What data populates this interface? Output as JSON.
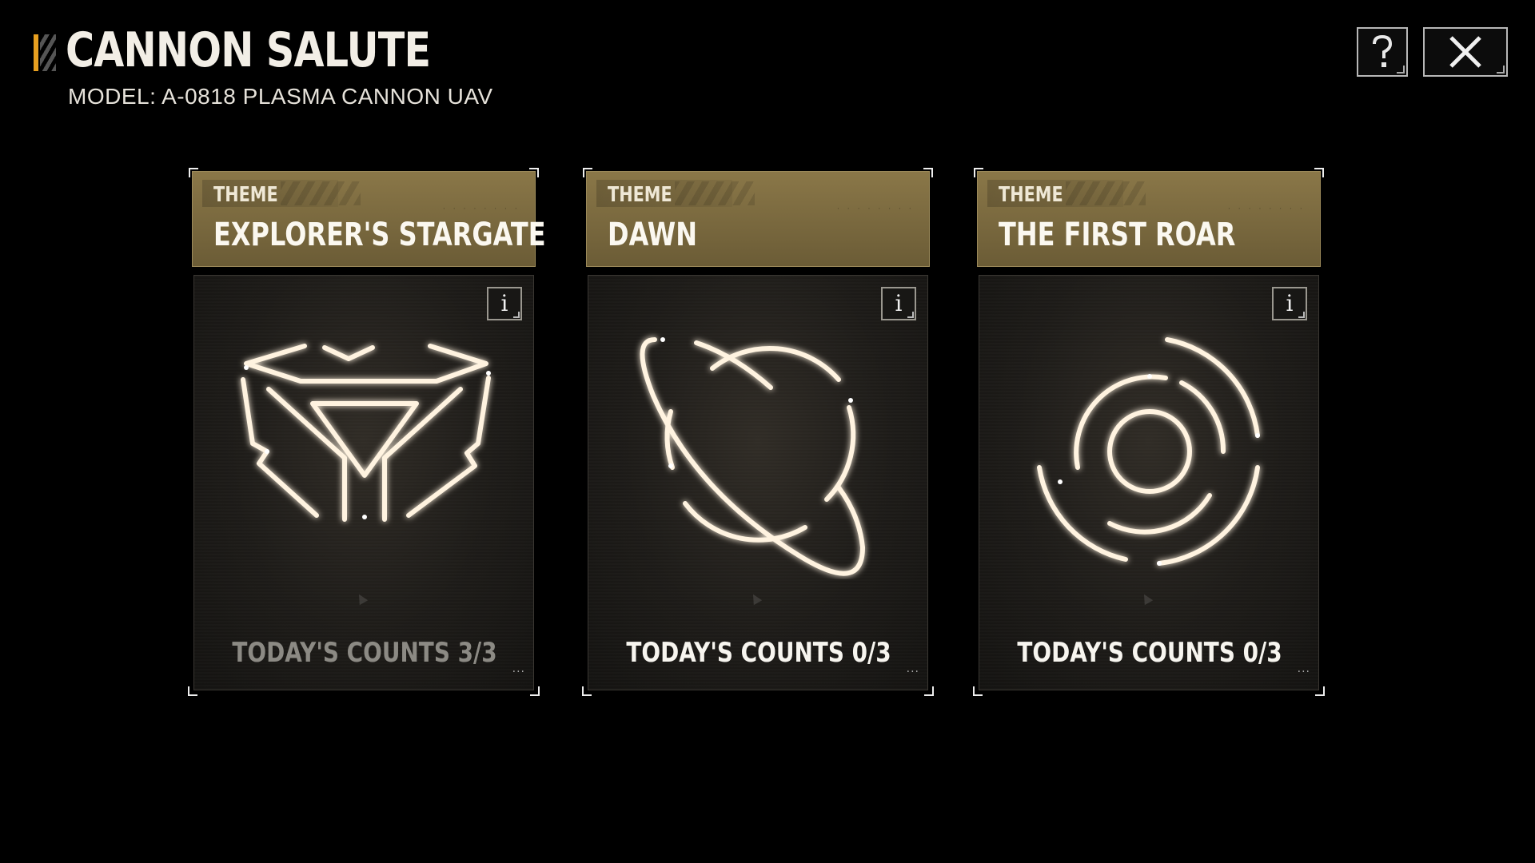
{
  "header": {
    "title": "CANNON SALUTE",
    "subtitle": "MODEL: A-0818 PLASMA CANNON UAV"
  },
  "buttons": {
    "help": "?",
    "close": "✕"
  },
  "colors": {
    "accent": "#e8a020",
    "card_header": "#8a7748",
    "glow": "#fff3e0"
  },
  "cards": [
    {
      "theme_label": "THEME",
      "theme_name": "EXPLORER'S STARGATE",
      "info_icon": "i",
      "icon": "cube-y-emblem-icon",
      "counts": "TODAY'S COUNTS 3/3",
      "status": "completed"
    },
    {
      "theme_label": "THEME",
      "theme_name": "DAWN",
      "info_icon": "i",
      "icon": "ringed-planet-icon",
      "counts": "TODAY'S COUNTS 0/3",
      "status": "available"
    },
    {
      "theme_label": "THEME",
      "theme_name": "THE FIRST ROAR",
      "info_icon": "i",
      "icon": "concentric-rings-icon",
      "counts": "TODAY'S COUNTS 0/3",
      "status": "available"
    }
  ]
}
